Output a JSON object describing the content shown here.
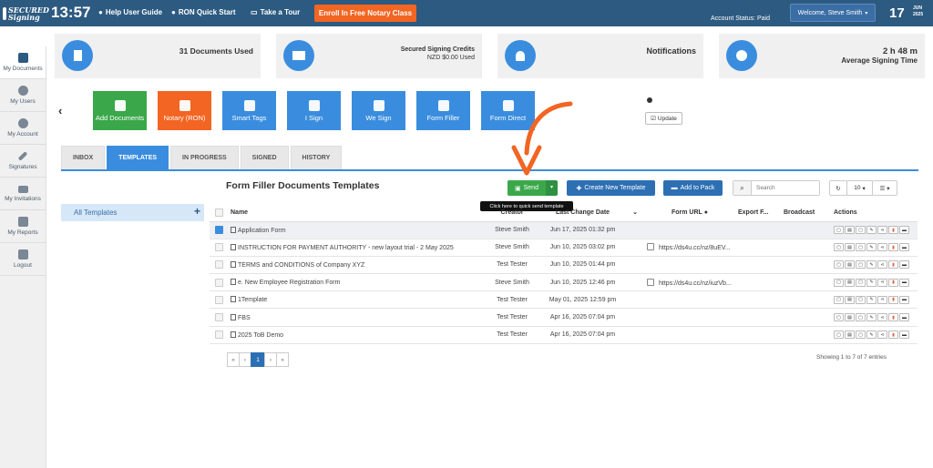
{
  "topbar": {
    "logo_text": "SECURED Signing",
    "clock": "13:57",
    "links": [
      "Help User Guide",
      "RON Quick Start",
      "Take a Tour"
    ],
    "enroll_label": "Enroll In Free Notary Class",
    "account_status": "Account Status: Paid",
    "welcome": "Welcome,  Steve Smith",
    "date_day": "17",
    "date_month": "JUN",
    "date_year": "2025"
  },
  "sidebar": {
    "items": [
      {
        "label": "My Documents",
        "icon": "document-icon"
      },
      {
        "label": "My Users",
        "icon": "user-icon"
      },
      {
        "label": "My Account",
        "icon": "gear-icon"
      },
      {
        "label": "Signatures",
        "icon": "pen-icon"
      },
      {
        "label": "My Invitations",
        "icon": "envelope-icon"
      },
      {
        "label": "My Reports",
        "icon": "chart-icon"
      },
      {
        "label": "Logout",
        "icon": "lock-icon"
      }
    ]
  },
  "cards": {
    "documents": "31 Documents Used",
    "credits_title": "Secured Signing Credits",
    "credits_value": "NZD $0.00 Used",
    "notifications": "Notifications",
    "time_value": "2 h 48 m",
    "time_label": "Average Signing Time"
  },
  "toolbar": {
    "tools": [
      {
        "label": "Add Documents",
        "color": "#3aa84a"
      },
      {
        "label": "Notary (RON)",
        "color": "#f26522"
      },
      {
        "label": "Smart Tags",
        "color": "#3a8dde"
      },
      {
        "label": "I Sign",
        "color": "#3a8dde"
      },
      {
        "label": "We Sign",
        "color": "#3a8dde"
      },
      {
        "label": "Form Filler",
        "color": "#3a8dde"
      },
      {
        "label": "Form Direct",
        "color": "#3a8dde"
      }
    ],
    "update_label": "Update"
  },
  "tabs": [
    "INBOX",
    "TEMPLATES",
    "IN PROGRESS",
    "SIGNED",
    "HISTORY"
  ],
  "left_panel": {
    "all_templates": "All Templates"
  },
  "main": {
    "title": "Form Filler Documents Templates",
    "send_label": "Send",
    "tooltip": "Click here to quick send template",
    "create_label": "Create New Template",
    "add_pack_label": "Add to Pack",
    "search_placeholder": "Search",
    "page_size": "10"
  },
  "table": {
    "headers": [
      "Name",
      "Creator",
      "Last Change Date",
      "Form URL",
      "Export F...",
      "Broadcast",
      "Actions"
    ],
    "rows": [
      {
        "name": "Application Form",
        "creator": "Steve Smith",
        "date": "Jun 17, 2025 01:32 pm",
        "url": "",
        "checked": true
      },
      {
        "name": "INSTRUCTION FOR PAYMENT AUTHORITY - new layout trial - 2 May 2025",
        "creator": "Steve Smith",
        "date": "Jun 10, 2025 03:02 pm",
        "url": "https://ds4u.cc/nz/8uEV...",
        "checked": false
      },
      {
        "name": "TERMS and CONDITIONS of Company XYZ",
        "creator": "Test Tester",
        "date": "Jun 10, 2025 01:44 pm",
        "url": "",
        "checked": false
      },
      {
        "name": "e. New Employee Registration Form",
        "creator": "Steve Smith",
        "date": "Jun 10, 2025 12:46 pm",
        "url": "https://ds4u.cc/nz/iuzVb...",
        "checked": false
      },
      {
        "name": "1Template",
        "creator": "Test Tester",
        "date": "May 01, 2025 12:59 pm",
        "url": "",
        "checked": false
      },
      {
        "name": "FBS",
        "creator": "Test Tester",
        "date": "Apr 16, 2025 07:04 pm",
        "url": "",
        "checked": false
      },
      {
        "name": "2025 ToB Demo",
        "creator": "Test Tester",
        "date": "Apr 16, 2025 07:04 pm",
        "url": "",
        "checked": false
      }
    ]
  },
  "pagination": {
    "pages": [
      "«",
      "‹",
      "1",
      "›",
      "»"
    ],
    "current": "1",
    "showing": "Showing 1 to 7 of 7 entries"
  },
  "colors": {
    "topbar": "#2d5a80",
    "accent": "#3a8dde",
    "orange": "#f26522",
    "green": "#3aa84a"
  }
}
